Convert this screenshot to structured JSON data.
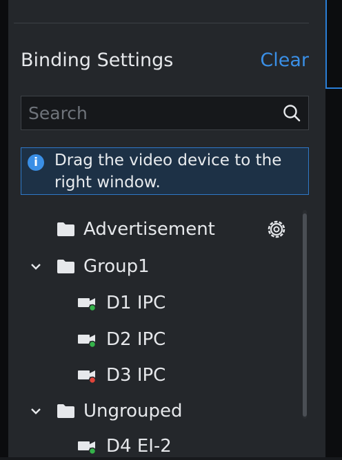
{
  "panel": {
    "title": "Binding Settings",
    "clear_label": "Clear"
  },
  "search": {
    "placeholder": "Search",
    "value": ""
  },
  "hint": {
    "text": "Drag the video device to the right window."
  },
  "tree": {
    "groups": [
      {
        "label": "Advertisement",
        "expanded": false
      },
      {
        "label": "Group1",
        "expanded": true
      },
      {
        "label": "Ungrouped",
        "expanded": true
      }
    ],
    "devices": [
      {
        "label": "D1 IPC",
        "status": "online",
        "status_color": "#35b34a"
      },
      {
        "label": "D2 IPC",
        "status": "online",
        "status_color": "#35b34a"
      },
      {
        "label": "D3 IPC",
        "status": "offline",
        "status_color": "#e0443a"
      },
      {
        "label": "D4 EI-2",
        "status": "online",
        "status_color": "#35b34a"
      }
    ]
  },
  "colors": {
    "accent": "#3a8fe6",
    "panel_bg": "#24272b",
    "online": "#35b34a",
    "offline": "#e0443a"
  }
}
